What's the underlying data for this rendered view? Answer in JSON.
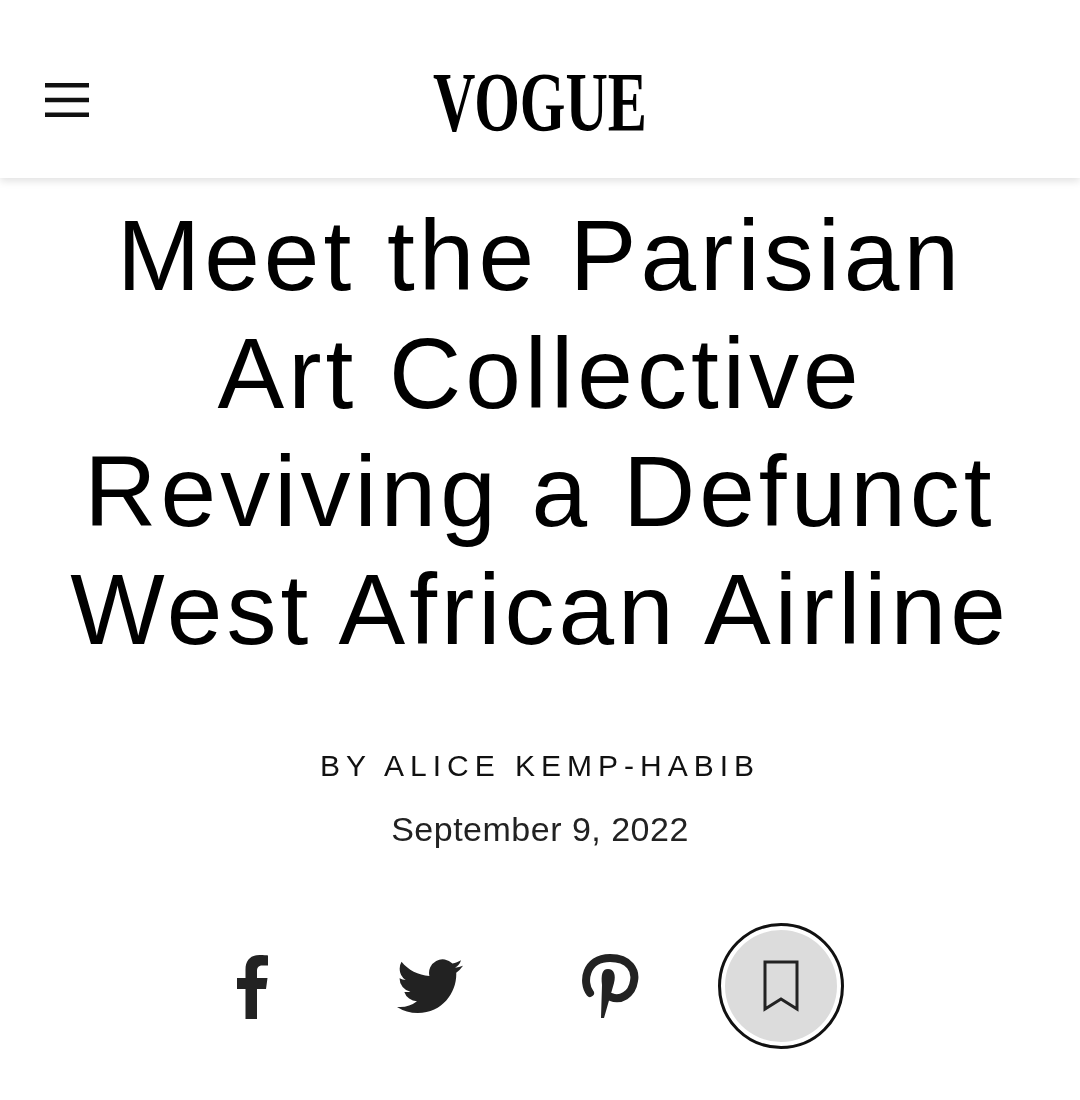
{
  "header": {
    "logo": "VOGUE"
  },
  "article": {
    "headline": "Meet the Parisian Art Collective Reviving a Defunct West African Airline",
    "byline": "BY ALICE KEMP-HABIB",
    "date": "September 9, 2022"
  }
}
